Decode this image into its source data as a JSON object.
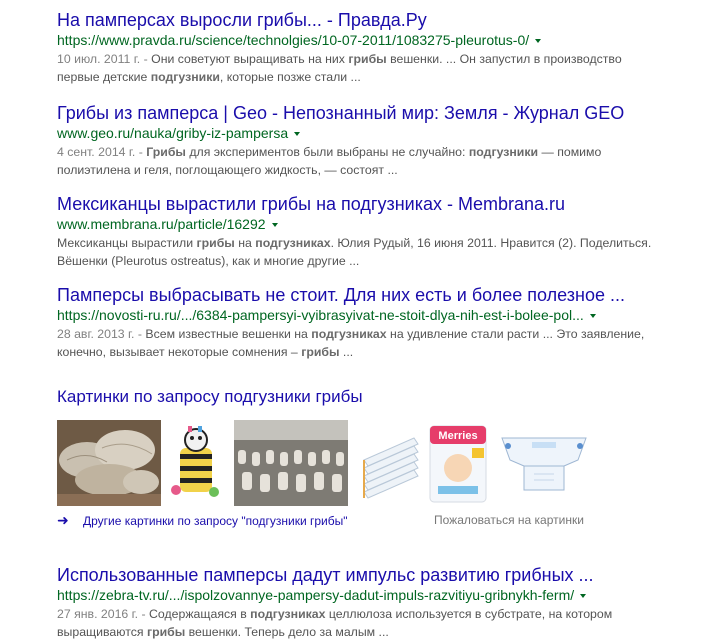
{
  "results": [
    {
      "title": "На памперсах выросли грибы... - Правда.Ру",
      "url": "https://www.pravda.ru/science/technolgies/10-07-2011/1083275-pleurotus-0/",
      "snippet": [
        {
          "t": "10 июл. 2011 г. - ",
          "date": true
        },
        {
          "t": "Они советуют выращивать на них "
        },
        {
          "t": "грибы",
          "b": true
        },
        {
          "t": " вешенки. ... Он запустил в производство первые детские "
        },
        {
          "t": "подгузники",
          "b": true
        },
        {
          "t": ", которые позже стали ..."
        }
      ]
    },
    {
      "title": "Грибы из памперса | Geo - Непознанный мир: Земля - Журнал GEO",
      "url": "www.geo.ru/nauka/griby-iz-pampersa",
      "snippet": [
        {
          "t": "4 сент. 2014 г. - ",
          "date": true
        },
        {
          "t": "Грибы",
          "b": true
        },
        {
          "t": " для экспериментов были выбраны не случайно: "
        },
        {
          "t": "подгузники",
          "b": true
        },
        {
          "t": " — помимо полиэтилена и геля, поглощающего жидкость, — состоят ..."
        }
      ]
    },
    {
      "title": "Мексиканцы вырастили грибы на подгузниках - Membrana.ru",
      "url": "www.membrana.ru/particle/16292",
      "snippet": [
        {
          "t": "Мексиканцы вырастили "
        },
        {
          "t": "грибы",
          "b": true
        },
        {
          "t": " на "
        },
        {
          "t": "подгузниках",
          "b": true
        },
        {
          "t": ". Юлия Рудый, 16 июня 2011. Нравится (2). Поделиться. Вёшенки (Pleurotus ostreatus), как и многие другие ..."
        }
      ]
    },
    {
      "title": "Памперсы выбрасывать не стоит. Для них есть и более полезное ...",
      "url": "https://novosti-ru.ru/.../6384-pampersyi-vyibrasyivat-ne-stoit-dlya-nih-est-i-bolee-pol...",
      "snippet": [
        {
          "t": "28 авг. 2013 г. - ",
          "date": true
        },
        {
          "t": "Всем известные вешенки на "
        },
        {
          "t": "подгузниках",
          "b": true
        },
        {
          "t": " на удивление стали расти ... Это заявление, конечно, вызывает некоторые сомнения – "
        },
        {
          "t": "грибы",
          "b": true
        },
        {
          "t": " ..."
        }
      ]
    },
    {
      "title": "Использованные памперсы дадут импульс развитию грибных ...",
      "url": "https://zebra-tv.ru/.../ispolzovannye-pampersy-dadut-impuls-razvitiyu-gribnykh-ferm/",
      "snippet": [
        {
          "t": "27 янв. 2016 г. - ",
          "date": true
        },
        {
          "t": "Содержащаяся в "
        },
        {
          "t": "подгузниках",
          "b": true
        },
        {
          "t": " целлюлоза используется в субстрате, на котором выращиваются "
        },
        {
          "t": "грибы",
          "b": true
        },
        {
          "t": " вешенки. Теперь дело за малым ..."
        }
      ]
    }
  ],
  "images": {
    "heading": "Картинки по запросу подгузники грибы",
    "more_label": "Другие картинки по запросу \"подгузники грибы\"",
    "report_label": "Пожаловаться на картинки",
    "thumbs": [
      {
        "name": "oyster-mushrooms-thumb"
      },
      {
        "name": "zebra-toy-thumb"
      },
      {
        "name": "mushroom-farm-thumb"
      },
      {
        "name": "diaper-stack-thumb"
      },
      {
        "name": "merries-pack-thumb"
      },
      {
        "name": "open-diaper-thumb"
      }
    ]
  },
  "colors": {
    "link": "#1a0dab",
    "url": "#006621",
    "snippet": "#545454"
  }
}
